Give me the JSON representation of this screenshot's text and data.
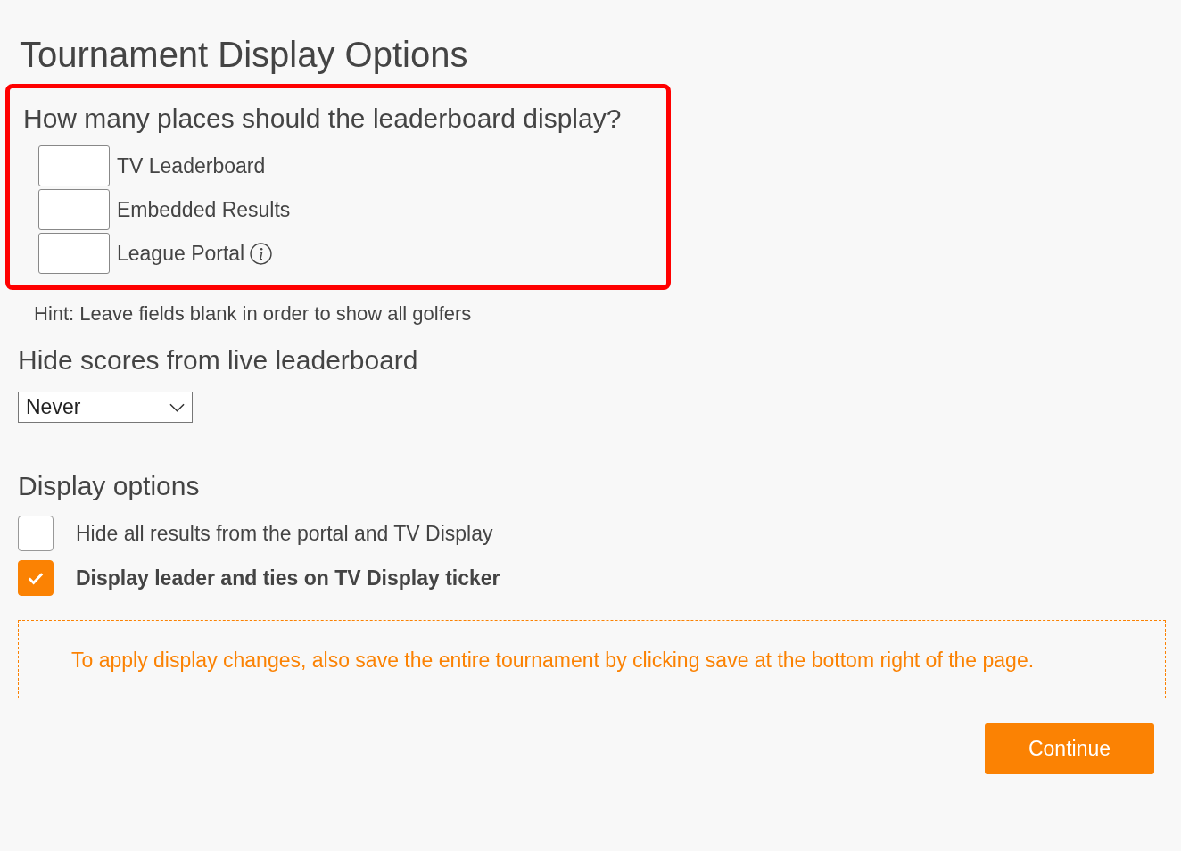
{
  "title": "Tournament Display Options",
  "places": {
    "question": "How many places should the leaderboard display?",
    "highlighted": true,
    "fields": [
      {
        "label": "TV Leaderboard",
        "info": false
      },
      {
        "label": "Embedded Results",
        "info": false
      },
      {
        "label": "League Portal",
        "info": true
      }
    ]
  },
  "hint": "Hint: Leave fields blank in order to show all golfers",
  "hide_scores": {
    "heading": "Hide scores from live leaderboard",
    "value": "Never"
  },
  "display_options": {
    "heading": "Display options",
    "items": [
      {
        "label": "Hide all results from the portal and TV Display",
        "checked": false
      },
      {
        "label": "Display leader and ties on TV Display ticker",
        "checked": true
      }
    ]
  },
  "notice": "To apply display changes, also save the entire tournament by clicking save at the bottom right of the page.",
  "buttons": [
    "Continue"
  ]
}
